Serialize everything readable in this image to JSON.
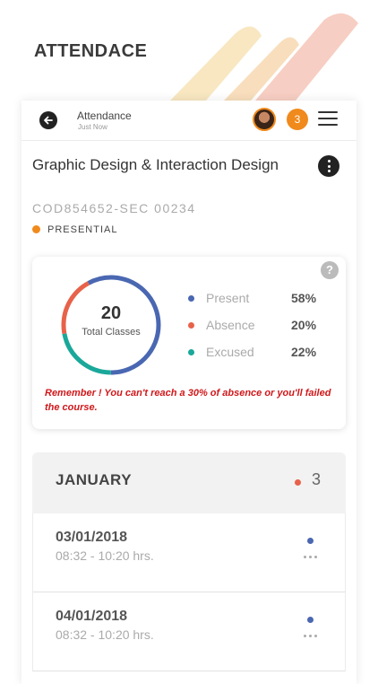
{
  "page": {
    "title": "ATTENDACE"
  },
  "appbar": {
    "title": "Attendance",
    "subtitle": "Just Now",
    "notification_count": "3"
  },
  "course": {
    "name": "Graphic Design & Interaction Design",
    "code": "COD854652-SEC 00234",
    "mode": "PRESENTIAL"
  },
  "summary": {
    "total_number": "20",
    "total_label": "Total Classes",
    "help_symbol": "?",
    "legend": [
      {
        "name": "Present",
        "percent": "58%",
        "value": 58,
        "color": "#4a67b2"
      },
      {
        "name": "Absence",
        "percent": "20%",
        "value": 20,
        "color": "#e8624a"
      },
      {
        "name": "Excused",
        "percent": "22%",
        "value": 22,
        "color": "#1aa89a"
      }
    ],
    "warning": "Remember ! You can't reach a 30% of absence or you'll failed the course."
  },
  "month": {
    "name": "JANUARY",
    "count": "3"
  },
  "sessions": [
    {
      "date": "03/01/2018",
      "time": "08:32  - 10:20 hrs."
    },
    {
      "date": "04/01/2018",
      "time": "08:32  - 10:20 hrs."
    }
  ],
  "colors": {
    "accent": "#f08a1c",
    "present": "#4a67b2",
    "absence": "#e8624a",
    "excused": "#1aa89a",
    "warning": "#d0181b"
  }
}
